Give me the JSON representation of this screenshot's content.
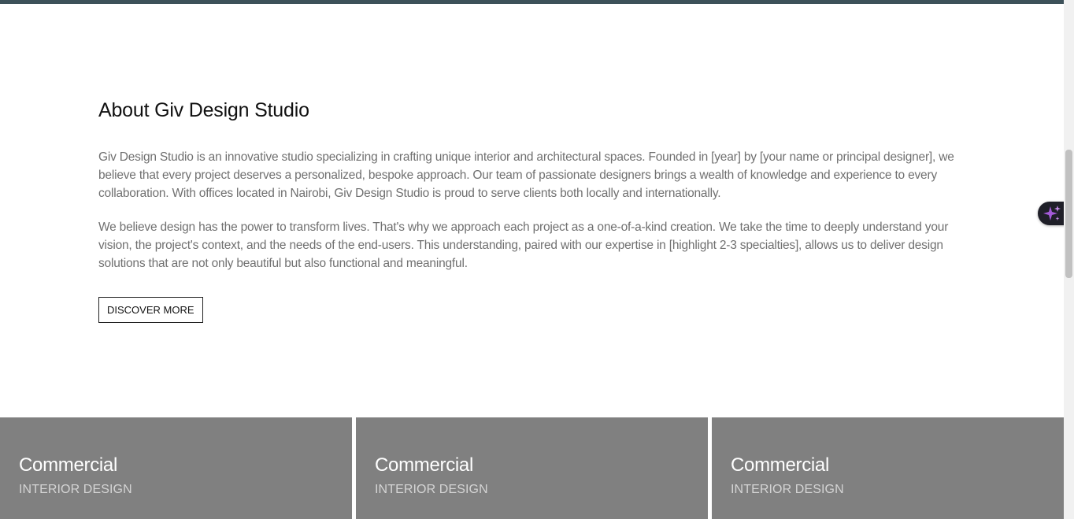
{
  "about": {
    "heading": "About Giv Design Studio",
    "paragraph1": "Giv Design Studio is an innovative studio specializing in crafting unique interior and architectural spaces. Founded in [year] by [your name or principal designer], we believe that every project deserves a personalized, bespoke approach. Our team of passionate designers brings a wealth of knowledge and experience to every collaboration. With offices located in Nairobi, Giv Design Studio is proud to serve clients both locally and internationally.",
    "paragraph2": "We believe design has the power to transform lives. That's why we approach each project as a one-of-a-kind creation. We take the time to deeply understand your vision, the project's context, and the needs of the end-users. This understanding, paired with our expertise in [highlight 2-3 specialties], allows us to deliver design solutions that are not only beautiful but also functional and meaningful.",
    "button_label": "DISCOVER MORE"
  },
  "cards": [
    {
      "title": "Commercial",
      "subtitle": "INTERIOR DESIGN"
    },
    {
      "title": "Commercial",
      "subtitle": "INTERIOR DESIGN"
    },
    {
      "title": "Commercial",
      "subtitle": "INTERIOR DESIGN"
    }
  ],
  "widget": {
    "icon": "sparkle-icon"
  },
  "colors": {
    "top_bar": "#3d5159",
    "card_bg": "#808080",
    "body_text": "#707070",
    "sparkle": "#a45ad8"
  }
}
